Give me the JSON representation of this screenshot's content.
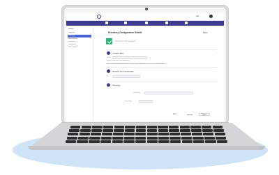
{
  "screen": {
    "topbar": {
      "right_text": "ahl"
    },
    "nav": {
      "items": [
        "",
        "",
        "",
        "",
        ""
      ]
    },
    "sidebar": {
      "header": "Assets",
      "items": [
        "Overview",
        "All Assets",
        "Asset Groups",
        "Discovery",
        "Credentials",
        "Scan Targets"
      ],
      "active_index": 1
    },
    "main": {
      "title": "Discovery Configuration Details",
      "back_label": "Back",
      "status_text": "Discovery Job Created",
      "section1": {
        "label": "Configuration",
        "field1_label": "Name",
        "field1_value": "",
        "note1": "Define scope and scan frequency",
        "note2": "Add networks and credentials to be used during discovery of assets in the environment"
      },
      "section2": {
        "label": "Network and Credentials",
        "field_label": "IP"
      },
      "section3": {
        "label": "Schedule",
        "field_label": "Frequency",
        "field2_label": "Start Time"
      },
      "buttons": {
        "previous": "Prev",
        "cancel": "Cancel",
        "save": "Save"
      }
    }
  }
}
